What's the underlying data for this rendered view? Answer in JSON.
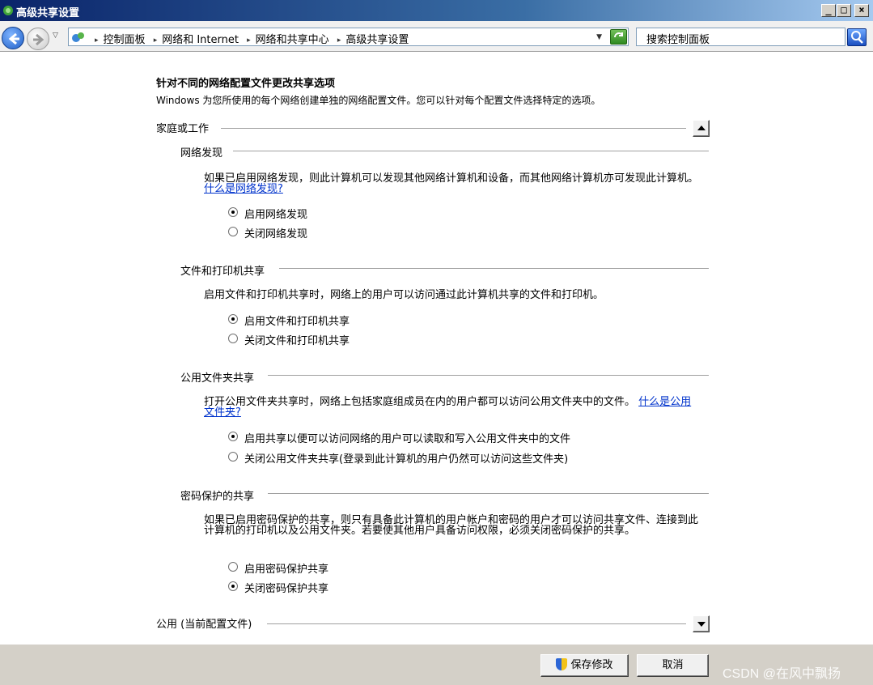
{
  "window": {
    "title": "高级共享设置"
  },
  "address": {
    "crumbs": [
      "控制面板",
      "网络和 Internet",
      "网络和共享中心",
      "高级共享设置"
    ],
    "search_placeholder": "搜索控制面板"
  },
  "content": {
    "title": "针对不同的网络配置文件更改共享选项",
    "description": "Windows 为您所使用的每个网络创建单独的网络配置文件。您可以针对每个配置文件选择特定的选项。",
    "profile_home": "家庭或工作",
    "profile_public": "公用 (当前配置文件)",
    "sections": {
      "discovery": {
        "title": "网络发现",
        "text": "如果已启用网络发现，则此计算机可以发现其他网络计算机和设备，而其他网络计算机亦可发现此计算机。",
        "link": "什么是网络发现?",
        "options": [
          "启用网络发现",
          "关闭网络发现"
        ]
      },
      "fileprint": {
        "title": "文件和打印机共享",
        "text": "启用文件和打印机共享时，网络上的用户可以访问通过此计算机共享的文件和打印机。",
        "options": [
          "启用文件和打印机共享",
          "关闭文件和打印机共享"
        ]
      },
      "publicfolder": {
        "title": "公用文件夹共享",
        "text": "打开公用文件夹共享时，网络上包括家庭组成员在内的用户都可以访问公用文件夹中的文件。",
        "link": "什么是公用文件夹?",
        "options": [
          "启用共享以便可以访问网络的用户可以读取和写入公用文件夹中的文件",
          "关闭公用文件夹共享(登录到此计算机的用户仍然可以访问这些文件夹)"
        ]
      },
      "password": {
        "title": "密码保护的共享",
        "text": "如果已启用密码保护的共享，则只有具备此计算机的用户帐户和密码的用户才可以访问共享文件、连接到此计算机的打印机以及公用文件夹。若要使其他用户具备访问权限，必须关闭密码保护的共享。",
        "options": [
          "启用密码保护共享",
          "关闭密码保护共享"
        ]
      }
    }
  },
  "footer": {
    "save_label": "保存修改",
    "cancel_label": "取消",
    "watermark": "CSDN @在风中飘扬"
  }
}
